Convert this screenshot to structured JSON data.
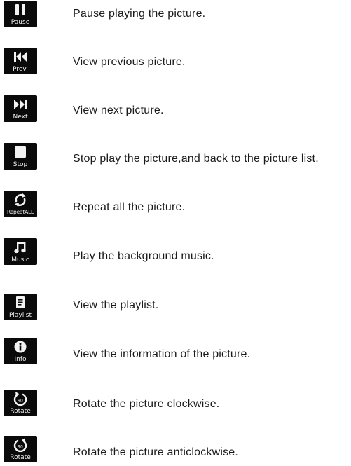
{
  "items": [
    {
      "icon": "pause-icon",
      "caption": "Pause",
      "description": "Pause playing the picture."
    },
    {
      "icon": "previous-icon",
      "caption": "Prev.",
      "description": "View previous picture."
    },
    {
      "icon": "next-icon",
      "caption": "Next",
      "description": "View next picture."
    },
    {
      "icon": "stop-icon",
      "caption": "Stop",
      "description": "Stop play the picture,and back to the picture list."
    },
    {
      "icon": "repeat-all-icon",
      "caption": "RepeatALL",
      "description": "Repeat all the picture."
    },
    {
      "icon": "music-note-icon",
      "caption": "Music",
      "description": "Play the background music."
    },
    {
      "icon": "playlist-icon",
      "caption": "Playlist",
      "description": "View the playlist."
    },
    {
      "icon": "info-icon",
      "caption": "Info",
      "description": "View the information of the picture."
    },
    {
      "icon": "rotate-clockwise-icon",
      "caption": "Rotate",
      "description": "Rotate the picture clockwise."
    },
    {
      "icon": "rotate-anticlockwise-icon",
      "caption": "Rotate",
      "description": "Rotate the picture anticlockwise."
    }
  ]
}
